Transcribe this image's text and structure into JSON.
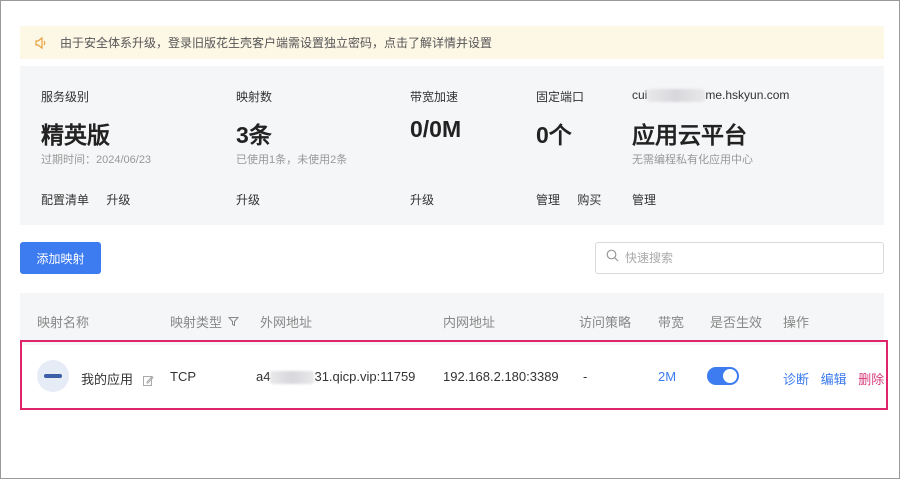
{
  "notice": {
    "text": "由于安全体系升级，登录旧版花生壳客户端需设置独立密码，点击了解详情并设置"
  },
  "stats": {
    "service": {
      "label": "服务级别",
      "value": "精英版",
      "sub": "过期时间：2024/06/23",
      "actions": [
        "配置清单",
        "升级"
      ]
    },
    "mappings": {
      "label": "映射数",
      "value": "3条",
      "sub": "已使用1条，未使用2条",
      "actions": [
        "升级"
      ]
    },
    "bandwidth": {
      "label": "带宽加速",
      "value": "0/0M",
      "actions": [
        "升级"
      ]
    },
    "ports": {
      "label": "固定端口",
      "value": "0个",
      "actions": [
        "管理",
        "购买"
      ]
    },
    "cloud": {
      "label_prefix": "cui",
      "label_suffix": "me.hskyun.com",
      "value": "应用云平台",
      "sub": "无需编程私有化应用中心",
      "actions": [
        "管理"
      ]
    }
  },
  "toolbar": {
    "add_label": "添加映射",
    "search_placeholder": "快速搜索"
  },
  "table": {
    "headers": [
      "映射名称",
      "映射类型",
      "外网地址",
      "内网地址",
      "访问策略",
      "带宽",
      "是否生效",
      "操作"
    ],
    "rows": [
      {
        "name": "我的应用",
        "type": "TCP",
        "external_prefix": "a4",
        "external_suffix": "31.qicp.vip:11759",
        "internal": "192.168.2.180:3389",
        "policy": "-",
        "bandwidth": "2M",
        "enabled": true,
        "actions": [
          "诊断",
          "编辑",
          "删除"
        ]
      }
    ]
  },
  "colors": {
    "accent": "#3c7bf0",
    "danger": "#d63d7a",
    "highlight_border": "#e0246a",
    "notice_bg": "#fdf7e6"
  }
}
